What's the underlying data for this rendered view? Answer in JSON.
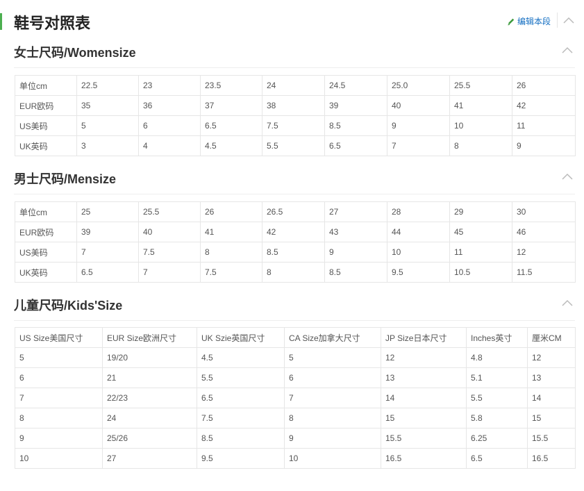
{
  "header": {
    "title": "鞋号对照表",
    "edit_label": "编辑本段",
    "collapse_icon": "chevron-up-icon"
  },
  "colors": {
    "accent_bar": "#4caf50",
    "link": "#136ec2",
    "border": "#e6e6e6"
  },
  "sections": [
    {
      "title": "女士尺码/Womensize",
      "rows": [
        [
          "单位cm",
          "22.5",
          "23",
          "23.5",
          "24",
          "24.5",
          "25.0",
          "25.5",
          "26"
        ],
        [
          "EUR欧码",
          "35",
          "36",
          "37",
          "38",
          "39",
          "40",
          "41",
          "42"
        ],
        [
          "US美码",
          "5",
          "6",
          "6.5",
          "7.5",
          "8.5",
          "9",
          "10",
          "11"
        ],
        [
          "UK英码",
          "3",
          "4",
          "4.5",
          "5.5",
          "6.5",
          "7",
          "8",
          "9"
        ]
      ]
    },
    {
      "title": "男士尺码/Mensize",
      "rows": [
        [
          "单位cm",
          "25",
          "25.5",
          "26",
          "26.5",
          "27",
          "28",
          "29",
          "30"
        ],
        [
          "EUR欧码",
          "39",
          "40",
          "41",
          "42",
          "43",
          "44",
          "45",
          "46"
        ],
        [
          "US美码",
          "7",
          "7.5",
          "8",
          "8.5",
          "9",
          "10",
          "11",
          "12"
        ],
        [
          "UK英码",
          "6.5",
          "7",
          "7.5",
          "8",
          "8.5",
          "9.5",
          "10.5",
          "11.5"
        ]
      ]
    },
    {
      "title": "儿童尺码/Kids'Size",
      "rows": [
        [
          "US Size美国尺寸",
          "EUR Size欧洲尺寸",
          "UK Szie英国尺寸",
          "CA Size加拿大尺寸",
          "JP Size日本尺寸",
          "Inches英寸",
          "厘米CM"
        ],
        [
          "5",
          "19/20",
          "4.5",
          "5",
          "12",
          "4.8",
          "12"
        ],
        [
          "6",
          "21",
          "5.5",
          "6",
          "13",
          "5.1",
          "13"
        ],
        [
          "7",
          "22/23",
          "6.5",
          "7",
          "14",
          "5.5",
          "14"
        ],
        [
          "8",
          "24",
          "7.5",
          "8",
          "15",
          "5.8",
          "15"
        ],
        [
          "9",
          "25/26",
          "8.5",
          "9",
          "15.5",
          "6.25",
          "15.5"
        ],
        [
          "10",
          "27",
          "9.5",
          "10",
          "16.5",
          "6.5",
          "16.5"
        ]
      ]
    }
  ]
}
